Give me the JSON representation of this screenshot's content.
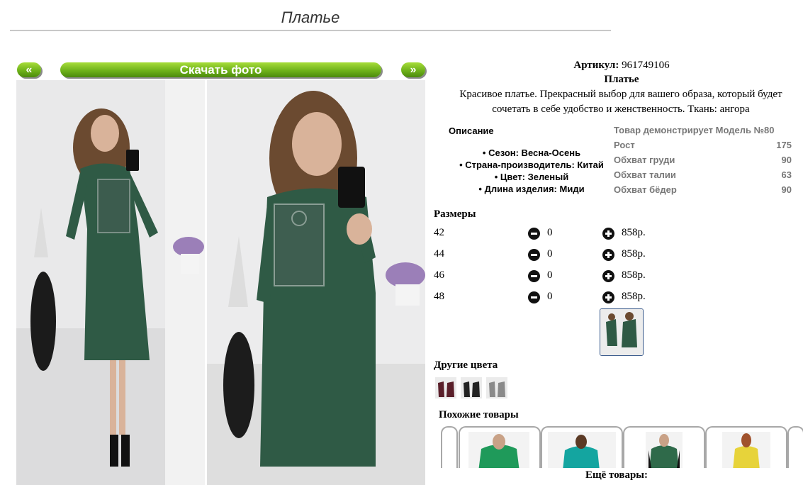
{
  "title": "Платье",
  "nav": {
    "prev": "«",
    "next": "»",
    "download": "Скачать фото"
  },
  "product": {
    "article_label": "Артикул:",
    "article_value": "961749106",
    "name": "Платье",
    "description": "Красивое платье. Прекрасный выбор для вашего образа, который будет сочетать в себе удобство и женственность. Ткань: ангора"
  },
  "description_block": {
    "heading": "Описание",
    "features": [
      "• Сезон: Весна-Осень",
      "• Страна-производитель: Китай",
      "• Цвет: Зеленый",
      "• Длина изделия: Миди"
    ]
  },
  "model_block": {
    "rows": [
      {
        "label": "Товар демонстрирует Модель №80",
        "value": ""
      },
      {
        "label": "Рост",
        "value": "175"
      },
      {
        "label": "Обхват груди",
        "value": "90"
      },
      {
        "label": "Обхват талии",
        "value": "63"
      },
      {
        "label": "Обхват бёдер",
        "value": "90"
      }
    ]
  },
  "sizes": {
    "heading": "Размеры",
    "rows": [
      {
        "size": "42",
        "qty": "0",
        "price": "858р."
      },
      {
        "size": "44",
        "qty": "0",
        "price": "858р."
      },
      {
        "size": "46",
        "qty": "0",
        "price": "858р."
      },
      {
        "size": "48",
        "qty": "0",
        "price": "858р."
      }
    ]
  },
  "other_colors": {
    "heading": "Другие цвета",
    "swatches": [
      "burgundy",
      "black",
      "gray"
    ]
  },
  "similar": {
    "heading": "Похожие товары",
    "more": "Ещё товары:"
  },
  "colors": {
    "accent_green": "#6fb21a",
    "dress_green": "#2f5a45",
    "muted_text": "#777777"
  }
}
